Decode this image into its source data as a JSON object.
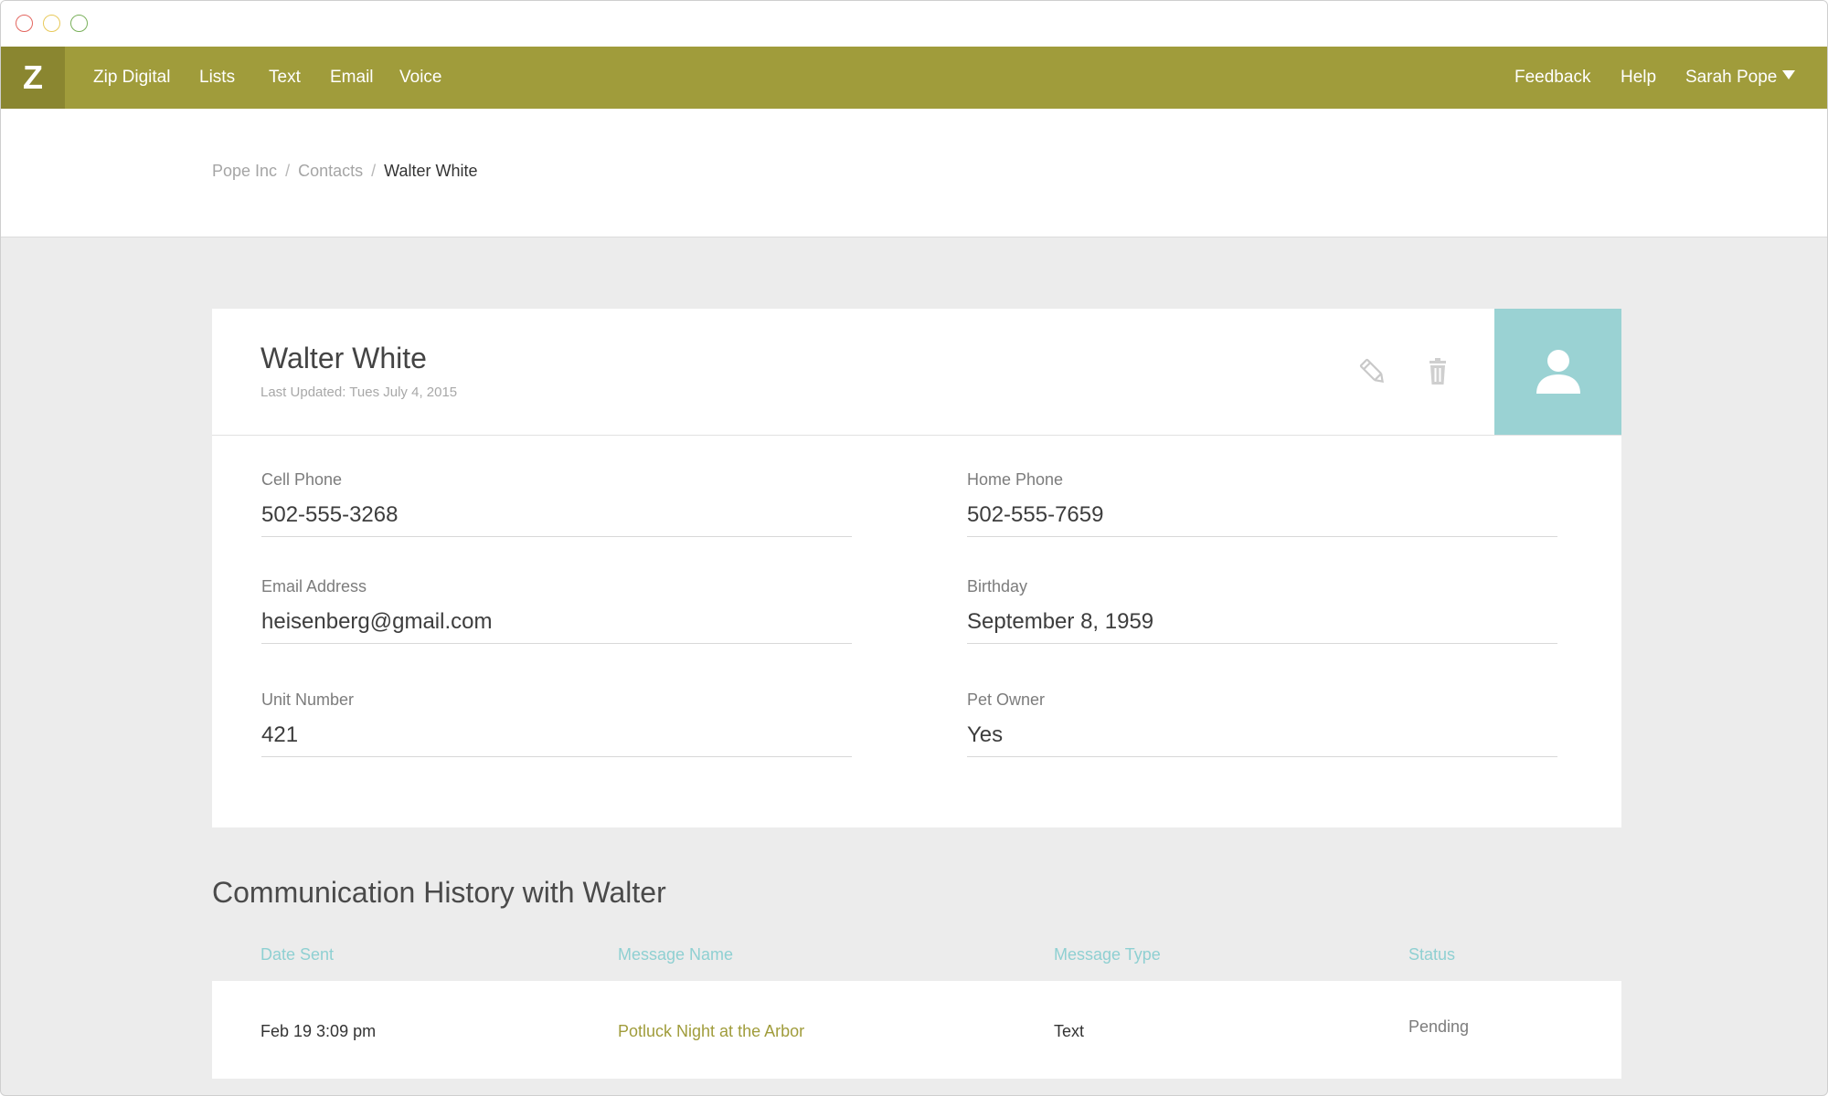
{
  "app": {
    "logo_letter": "Z",
    "nav": {
      "brand": "Zip Digital",
      "items": [
        "Lists",
        "Text",
        "Email",
        "Voice"
      ],
      "right_items": [
        "Feedback",
        "Help"
      ],
      "user": "Sarah Pope"
    },
    "colors": {
      "navbar": "#a09c3b",
      "logo_bg": "#8a8630",
      "avatar_bg": "#9ad2d3",
      "column_header": "#8fd0d2",
      "link_olive": "#a09c3b"
    }
  },
  "breadcrumb": [
    "Pope Inc",
    "Contacts",
    "Walter White"
  ],
  "contact": {
    "name": "Walter White",
    "last_updated": "Last Updated: Tues July 4, 2015",
    "icons": {
      "edit": "pencil-icon",
      "delete": "trash-icon",
      "avatar": "person-icon"
    },
    "fields": [
      {
        "label": "Cell Phone",
        "value": "502-555-3268"
      },
      {
        "label": "Home Phone",
        "value": "502-555-7659"
      },
      {
        "label": "Email Address",
        "value": "heisenberg@gmail.com"
      },
      {
        "label": "Birthday",
        "value": "September 8, 1959"
      },
      {
        "label": "Unit Number",
        "value": "421"
      },
      {
        "label": "Pet Owner",
        "value": "Yes"
      }
    ]
  },
  "history": {
    "title": "Communication History with Walter",
    "columns": [
      "Date Sent",
      "Message Name",
      "Message Type",
      "Status"
    ],
    "rows": [
      {
        "date_sent": "Feb 19 3:09 pm",
        "message_name": "Potluck Night at the Arbor",
        "message_type": "Text",
        "status": "Pending"
      }
    ]
  }
}
